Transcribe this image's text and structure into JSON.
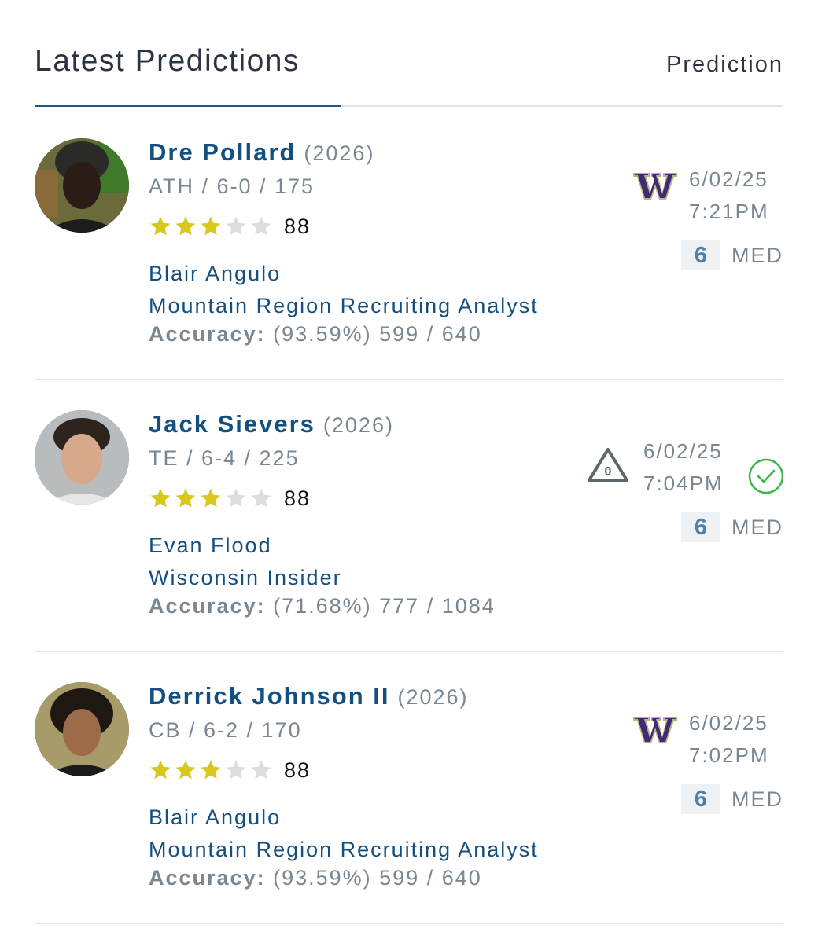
{
  "header": {
    "title": "Latest Predictions",
    "column_label": "Prediction"
  },
  "colors": {
    "accent": "#13507f",
    "star_filled": "#d8c81c",
    "star_empty": "#d9d9d9",
    "check": "#3bb54a",
    "washington_purple": "#3b2c77",
    "washington_gold": "#c5b27a"
  },
  "predictions": [
    {
      "name": "Dre Pollard",
      "year": "(2026)",
      "meta": "ATH / 6-0 / 175",
      "stars": 3,
      "rating": "88",
      "analyst": "Blair Angulo",
      "analyst_title": "Mountain Region Recruiting Analyst",
      "accuracy_label": "Accuracy:",
      "accuracy_value": "(93.59%) 599 / 640",
      "pick_icon": "washington-w-logo",
      "date": "6/02/25",
      "time": "7:21PM",
      "confidence": "6",
      "confidence_label": "MED"
    },
    {
      "name": "Jack Sievers",
      "year": "(2026)",
      "meta": "TE / 6-4 / 225",
      "stars": 3,
      "rating": "88",
      "analyst": "Evan Flood",
      "analyst_title": "Wisconsin Insider",
      "accuracy_label": "Accuracy:",
      "accuracy_value": "(71.68%) 777 / 1084",
      "pick_icon": "delta-warning-icon",
      "pick_icon_text": "0",
      "date": "6/02/25",
      "time": "7:04PM",
      "status_icon": "check-circle-icon",
      "confidence": "6",
      "confidence_label": "MED"
    },
    {
      "name": "Derrick Johnson II",
      "year": "(2026)",
      "meta": "CB / 6-2 / 170",
      "stars": 3,
      "rating": "88",
      "analyst": "Blair Angulo",
      "analyst_title": "Mountain Region Recruiting Analyst",
      "accuracy_label": "Accuracy:",
      "accuracy_value": "(93.59%) 599 / 640",
      "pick_icon": "washington-w-logo",
      "date": "6/02/25",
      "time": "7:02PM",
      "confidence": "6",
      "confidence_label": "MED"
    }
  ]
}
